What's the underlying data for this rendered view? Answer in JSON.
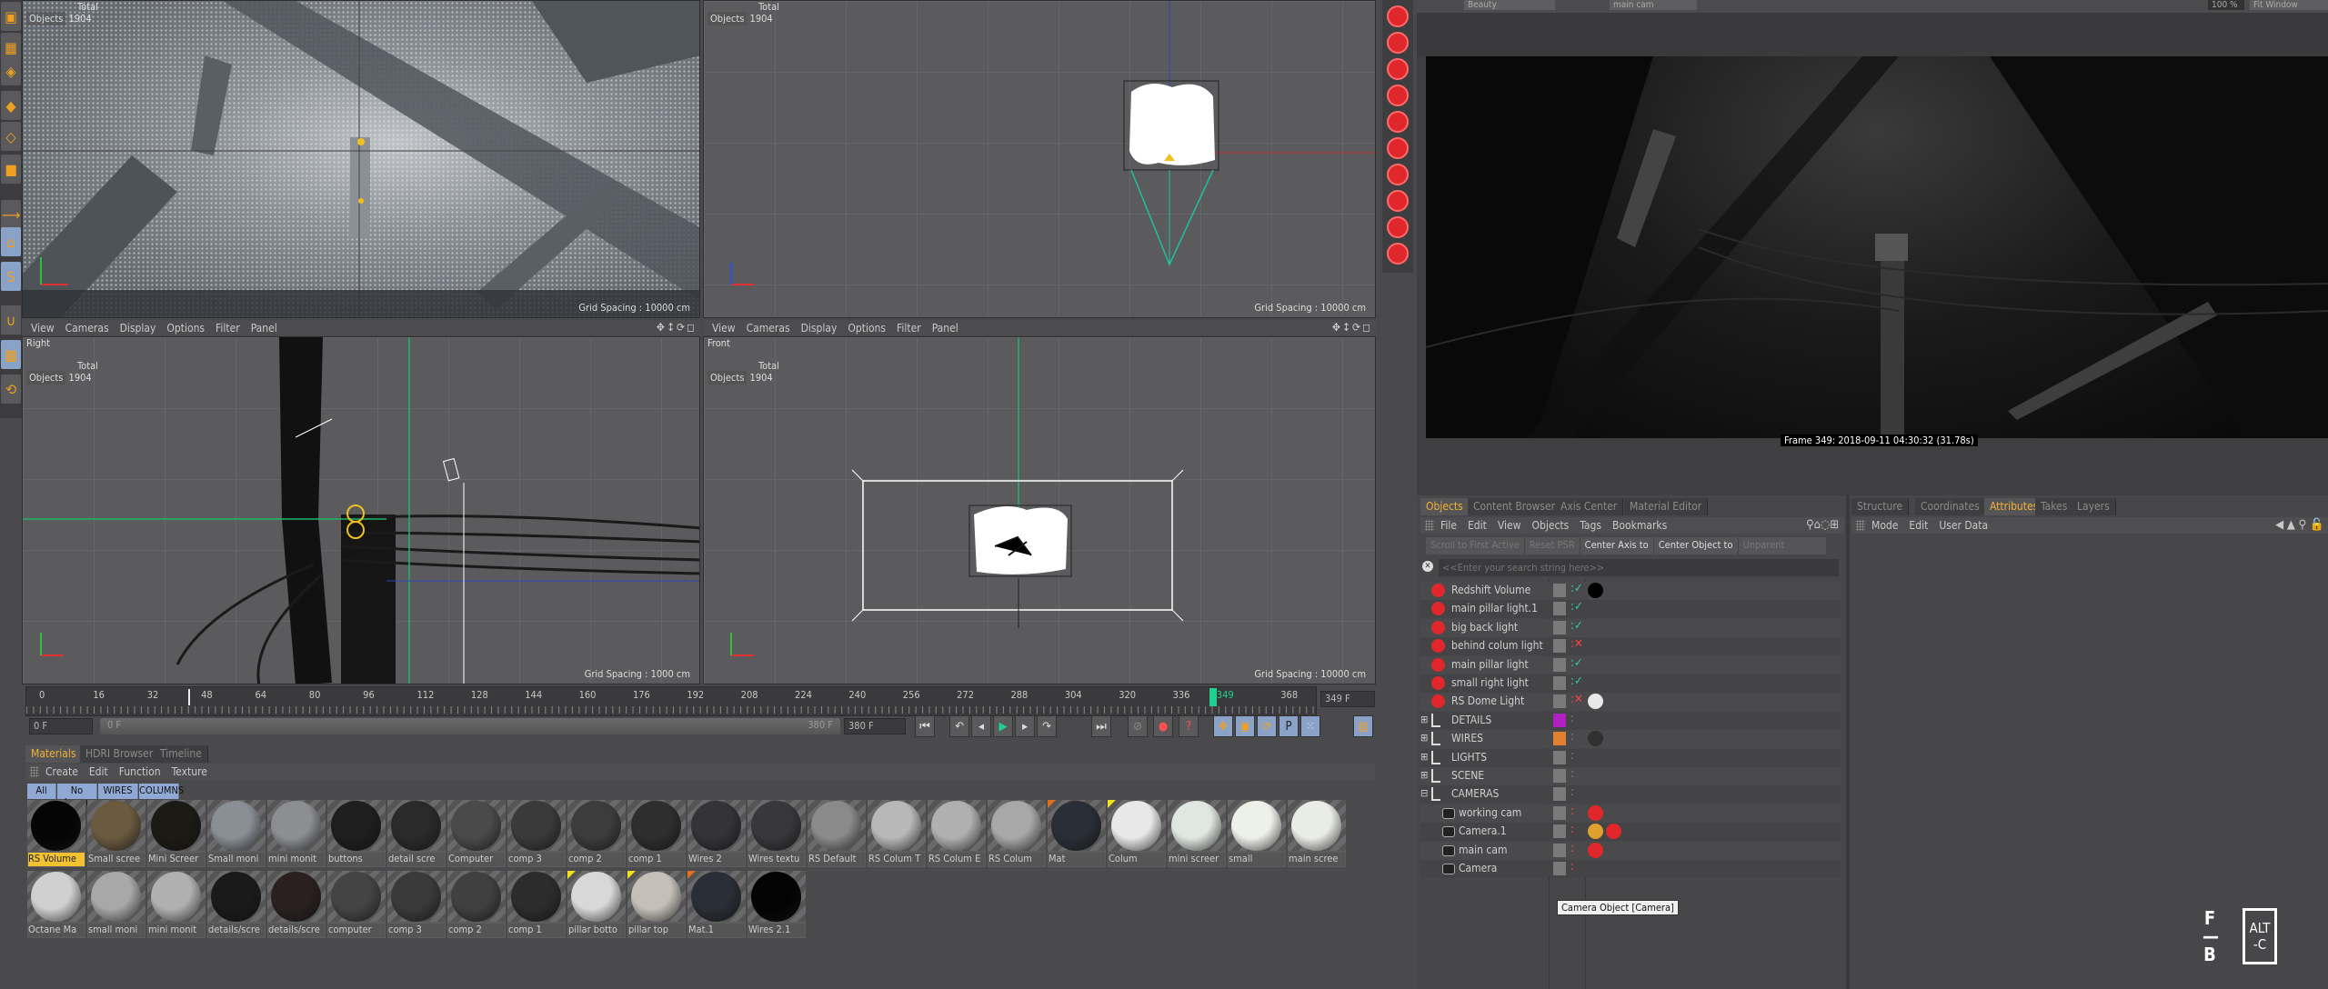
{
  "viewports": {
    "top_left": {
      "hud_total": "Total",
      "hud_objects_label": "Objects",
      "hud_objects": "1904",
      "grid": "Grid Spacing : 10000 cm"
    },
    "top_right": {
      "hud_total": "Total",
      "hud_objects_label": "Objects",
      "hud_objects": "1904",
      "grid": "Grid Spacing : 10000 cm"
    },
    "bottom_left": {
      "name": "Right",
      "hud_total": "Total",
      "hud_objects_label": "Objects",
      "hud_objects": "1904",
      "grid": "Grid Spacing : 1000 cm",
      "menu": [
        "View",
        "Cameras",
        "Display",
        "Options",
        "Filter",
        "Panel"
      ]
    },
    "bottom_right": {
      "name": "Front",
      "hud_total": "Total",
      "hud_objects_label": "Objects",
      "hud_objects": "1904",
      "grid": "Grid Spacing : 10000 cm",
      "menu": [
        "View",
        "Cameras",
        "Display",
        "Options",
        "Filter",
        "Panel"
      ]
    }
  },
  "timeline": {
    "ticks": [
      "0",
      "16",
      "32",
      "48",
      "64",
      "80",
      "96",
      "112",
      "128",
      "144",
      "160",
      "176",
      "192",
      "208",
      "224",
      "240",
      "256",
      "272",
      "288",
      "304",
      "320",
      "336",
      "349",
      "368"
    ],
    "current_frame": 349,
    "current_label": "349 F",
    "start": "0 F",
    "range_start": "0 F",
    "range_end": "380 F",
    "end": "380 F"
  },
  "materials": {
    "tabs": [
      "Materials",
      "HDRI Browser",
      "Timeline"
    ],
    "menu": [
      "Create",
      "Edit",
      "Function",
      "Texture"
    ],
    "filters": [
      "All",
      "No Layer",
      "WIRES",
      "COLUMNS"
    ],
    "row1": [
      {
        "name": "RS Volume",
        "tone": "#050505",
        "selected": true
      },
      {
        "name": "Small scree",
        "tone": "#6b5a40"
      },
      {
        "name": "Mini Screer",
        "tone": "#1c1a14"
      },
      {
        "name": "Small moni",
        "tone": "#8a8f96"
      },
      {
        "name": "mini monit",
        "tone": "#8c8e92"
      },
      {
        "name": "buttons",
        "tone": "#1e1e1e"
      },
      {
        "name": "detail scre",
        "tone": "#2a2a2a"
      },
      {
        "name": "Computer",
        "tone": "#4a4a4a"
      },
      {
        "name": "comp 3",
        "tone": "#3a3a3a"
      },
      {
        "name": "comp 2",
        "tone": "#3c3c3c"
      },
      {
        "name": "comp 1",
        "tone": "#2e2e2e"
      },
      {
        "name": "Wires 2",
        "tone": "#333338"
      },
      {
        "name": "Wires textu",
        "tone": "#38383c"
      },
      {
        "name": "RS Default",
        "tone": "#8a8a8a"
      },
      {
        "name": "RS Colum T",
        "tone": "#b8b8b8"
      },
      {
        "name": "RS Colum E",
        "tone": "#b0b0b0"
      },
      {
        "name": "RS Colum",
        "tone": "#a8a8a8"
      },
      {
        "name": "Mat",
        "tone": "#2a2e36",
        "flag": "#e07020"
      },
      {
        "name": "Colum",
        "tone": "#e8e8e8",
        "flag": "#f0e020"
      },
      {
        "name": "mini screer",
        "tone": "#e0e6e0"
      },
      {
        "name": "small",
        "tone": "#eef0ea"
      },
      {
        "name": "main scree",
        "tone": "#eaece6"
      }
    ],
    "row2": [
      {
        "name": "Octane Ma",
        "tone": "#d0d0d0"
      },
      {
        "name": "small moni",
        "tone": "#a8a8a8"
      },
      {
        "name": "mini monit",
        "tone": "#b0b0b0"
      },
      {
        "name": "details/scre",
        "tone": "#1a1a1a"
      },
      {
        "name": "details/scre",
        "tone": "#2a2020"
      },
      {
        "name": "computer",
        "tone": "#444"
      },
      {
        "name": "comp 3",
        "tone": "#3a3a3a"
      },
      {
        "name": "comp 2",
        "tone": "#404040"
      },
      {
        "name": "comp 1",
        "tone": "#2c2c2c"
      },
      {
        "name": "pillar botto",
        "tone": "#d8d8d8",
        "flag": "#f0e020"
      },
      {
        "name": "pillar top",
        "tone": "#c4c0b8",
        "flag": "#f0e020"
      },
      {
        "name": "Mat.1",
        "tone": "#2a2e36",
        "flag": "#e07020"
      },
      {
        "name": "Wires 2.1",
        "tone": "#030303"
      }
    ]
  },
  "render_view": {
    "toolbar": {
      "channel": "Beauty",
      "camera": "main cam",
      "zoom": "100 %",
      "fit": "Fit Window"
    },
    "caption": "Frame 349: 2018-09-11 04:30:32 (31.78s)"
  },
  "objects_panel": {
    "tabs": [
      "Objects",
      "Content Browser",
      "Axis Center",
      "Material Editor"
    ],
    "menu": [
      "File",
      "Edit",
      "View",
      "Objects",
      "Tags",
      "Bookmarks"
    ],
    "buttons": [
      "Scroll to First Active",
      "Reset PSR",
      "Center Axis to",
      "Center Object to",
      "Unparent"
    ],
    "search_placeholder": "<<Enter your search string here>>",
    "rows": [
      {
        "name": "Redshift Volume",
        "type": "light",
        "status": "on",
        "tag": "#000000"
      },
      {
        "name": "main pillar light.1",
        "type": "light",
        "status": "on"
      },
      {
        "name": "big back light",
        "type": "light",
        "status": "on"
      },
      {
        "name": "behind colum light",
        "type": "light",
        "status": "off"
      },
      {
        "name": "main pillar light",
        "type": "light",
        "status": "on"
      },
      {
        "name": "small right light",
        "type": "light",
        "status": "on"
      },
      {
        "name": "RS Dome Light",
        "type": "light",
        "status": "off",
        "tag": "#e8e8e8"
      },
      {
        "name": "DETAILS",
        "type": "null",
        "layer": "#b020c0"
      },
      {
        "name": "WIRES",
        "type": "null",
        "layer": "#e08030",
        "tag": "#303030"
      },
      {
        "name": "LIGHTS",
        "type": "null"
      },
      {
        "name": "SCENE",
        "type": "null"
      },
      {
        "name": "CAMERAS",
        "type": "null"
      },
      {
        "name": "working cam",
        "type": "cam",
        "tag": "#e0282c"
      },
      {
        "name": "Camera.1",
        "type": "cam",
        "tag": "#e0a030",
        "tag2": "#e0282c"
      },
      {
        "name": "main cam",
        "type": "cam",
        "tag": "#e0282c"
      },
      {
        "name": "Camera",
        "type": "cam"
      }
    ]
  },
  "attributes_panel": {
    "tabs": [
      "Structure",
      "Coordinates",
      "Attributes",
      "Takes",
      "Layers"
    ],
    "menu": [
      "Mode",
      "Edit",
      "User Data"
    ]
  },
  "tooltip": "Camera Object [Camera]",
  "logo": {
    "left": "F B",
    "box": "ALT -C"
  },
  "colors": {
    "accent": "#f2b233",
    "selection": "#8fa9d4",
    "tool_red": "#e0282c",
    "axis_green": "#1fb36a"
  }
}
